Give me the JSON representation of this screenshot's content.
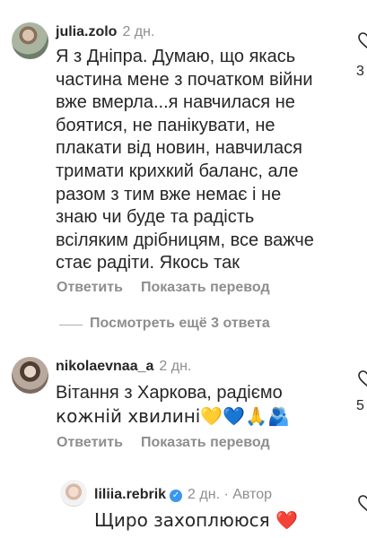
{
  "comments": [
    {
      "username": "julia.zolo",
      "time": "2 дн.",
      "text": "Я з Дніпра. Думаю, що якась частина мене з початком війни вже вмерла...я навчилася не боятися, не панікувати, не плакати від новин, навчилася тримати крихкий баланс, але разом з тим вже немає і не знаю чи буде та радість всіляким дрібницям, все важче стає радіти. Якось так",
      "lines": [
        "Я з Дніпра. Думаю, що якась",
        "частина мене з початком війни",
        "вже вмерла...я навчилася не",
        "боятися, не панікувати, не",
        "плакати від новин, навчилася",
        "тримати крихкий баланс, але",
        "разом з тим вже немає і не",
        "знаю чи буде та радість",
        "всіляким дрібницям, все важче",
        "стає радіти. Якось так"
      ],
      "reply_label": "Ответить",
      "translate_label": "Показать перевод",
      "like_count": "3"
    },
    {
      "username": "nikolaevnaa_a",
      "time": "2 дн.",
      "lines": [
        "Вітання з Харкова, радіємо",
        "кожній хвилині💛💙🙏🫂"
      ],
      "reply_label": "Ответить",
      "translate_label": "Показать перевод",
      "like_count": "5"
    },
    {
      "username": "liliia.rebrik",
      "time": "2 дн.",
      "author_badge": "Автор",
      "separator": "·",
      "text": "Щиро захоплююся ❤️"
    }
  ],
  "more_replies_label": "Посмотреть ещё 3 ответа",
  "colors": {
    "text": "#262626",
    "secondary": "#8e8e8e",
    "verified": "#3897f0"
  },
  "icons": [
    "heart-icon",
    "verified-badge-icon"
  ]
}
